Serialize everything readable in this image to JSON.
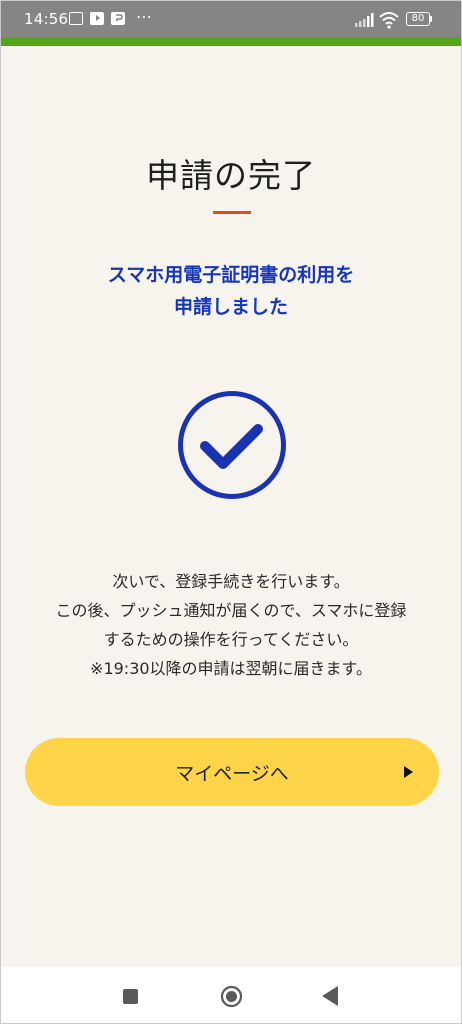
{
  "status_bar": {
    "time": "14:56",
    "dots": "⋯",
    "battery": "80"
  },
  "main": {
    "title": "申請の完了",
    "lead_line1": "スマホ用電子証明書の利用を",
    "lead_line2": "申請しました",
    "body_line1": "次いで、登録手続きを行います。",
    "body_line2": "この後、プッシュ通知が届くので、スマホに登録",
    "body_line3": "するための操作を行ってください。",
    "body_line4": "※19:30以降の申請は翌朝に届きます。",
    "button_label": "マイページへ"
  },
  "colors": {
    "accent_green": "#56a417",
    "underline_red": "#e04c1e",
    "lead_blue": "#1636b8",
    "button_yellow": "#ffd448"
  },
  "icons": {
    "status": [
      "app-notification-icon",
      "youtube-icon",
      "app-icon",
      "signal-icon",
      "wifi-icon",
      "battery-icon"
    ],
    "main": "checkmark-circle-icon",
    "button_arrow": "triangle-right-icon",
    "nav": [
      "recents-icon",
      "home-icon",
      "back-icon"
    ]
  }
}
